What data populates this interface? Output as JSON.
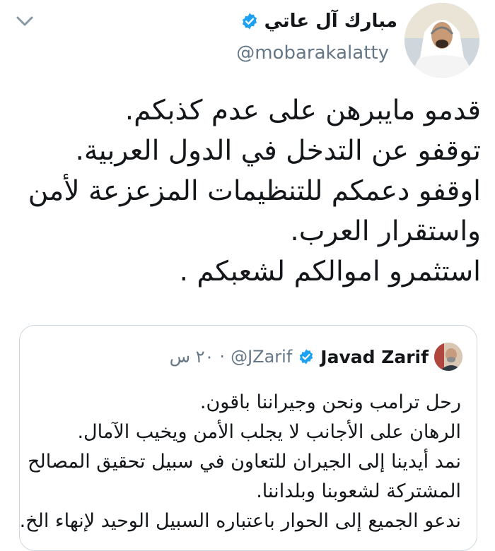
{
  "tweet": {
    "author_name": "مبارك آل عاتي",
    "author_handle": "@mobarakalatty",
    "lines": [
      "قدمو مايبرهن على عدم كذبكم.",
      "توقفو عن التدخل في  الدول العربية.",
      "اوقفو دعمكم للتنظيمات المزعزعة لأمن",
      "واستقرار العرب.",
      "استثمرو اموالكم لشعبكم ."
    ]
  },
  "quoted_tweet": {
    "author_name": "Javad Zarif",
    "author_handle": "@JZarif",
    "separator": "·",
    "time": "٢٠ س",
    "lines": [
      "رحل ترامب ونحن وجيراننا باقون.",
      "الرهان على الأجانب لا يجلب الأمن ويخيب الآمال.",
      "نمد أيدينا إلى الجيران للتعاون في سبيل تحقيق المصالح",
      "المشتركة لشعوبنا وبلداننا.",
      "ندعو الجميع إلى الحوار باعتباره السبيل الوحيد لإنهاء الخ..."
    ]
  },
  "colors": {
    "verified": "#1da1f2",
    "secondary_text": "#657786",
    "border": "#ccd6dd"
  },
  "icons": {
    "menu": "chevron-down-icon",
    "verified": "verified-badge-icon"
  }
}
